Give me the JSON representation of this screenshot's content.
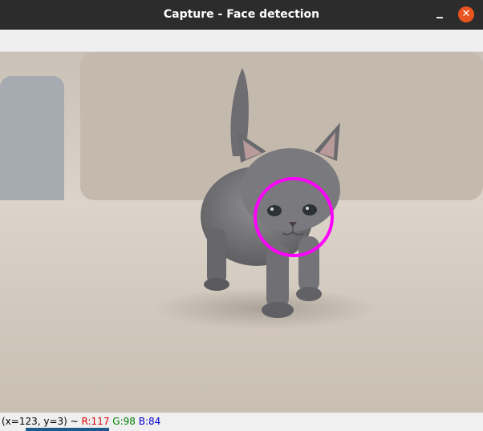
{
  "window": {
    "title": "Capture - Face detection",
    "close_glyph": "✕",
    "minimize_icon": "minimize-icon",
    "close_icon": "close-icon",
    "close_color": "#e95420",
    "titlebar_color": "#2c2c2c"
  },
  "image": {
    "subject": "gray kitten walking on carpet",
    "detection_color": "#ff00ff",
    "detection_icon": "face-detection-circle"
  },
  "status": {
    "coords": "(x=123, y=3) ~ ",
    "r": "R:117",
    "g": "G:98",
    "b": "B:84",
    "r_color": "#e00000",
    "g_color": "#008000",
    "b_color": "#0000d0"
  }
}
